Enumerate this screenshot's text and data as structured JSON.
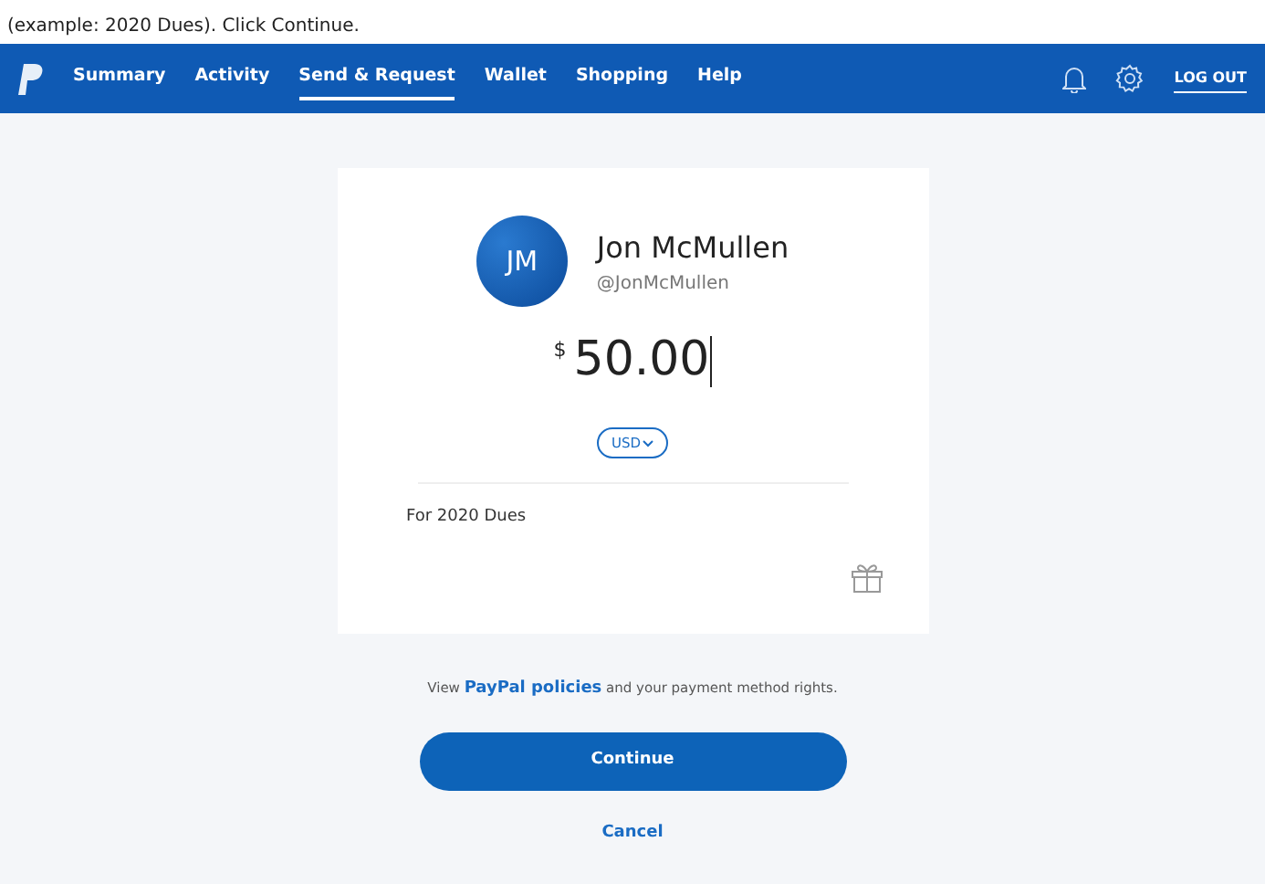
{
  "caption": "(example: 2020 Dues). Click Continue.",
  "nav": {
    "items": [
      {
        "label": "Summary",
        "selected": false
      },
      {
        "label": "Activity",
        "selected": false
      },
      {
        "label": "Send & Request",
        "selected": true
      },
      {
        "label": "Wallet",
        "selected": false
      },
      {
        "label": "Shopping",
        "selected": false
      },
      {
        "label": "Help",
        "selected": false
      }
    ],
    "logout": "LOG OUT"
  },
  "recipient": {
    "initials": "JM",
    "name": "Jon McMullen",
    "handle": "@JonMcMullen"
  },
  "amount": {
    "currency_symbol": "$",
    "value": "50.00",
    "currency": "USD"
  },
  "note": {
    "value": "For 2020 Dues"
  },
  "policy": {
    "text": "View **PayPal policies** and your payment method rights."
  },
  "buttons": {
    "continue": "Continue",
    "cancel": "Cancel"
  }
}
